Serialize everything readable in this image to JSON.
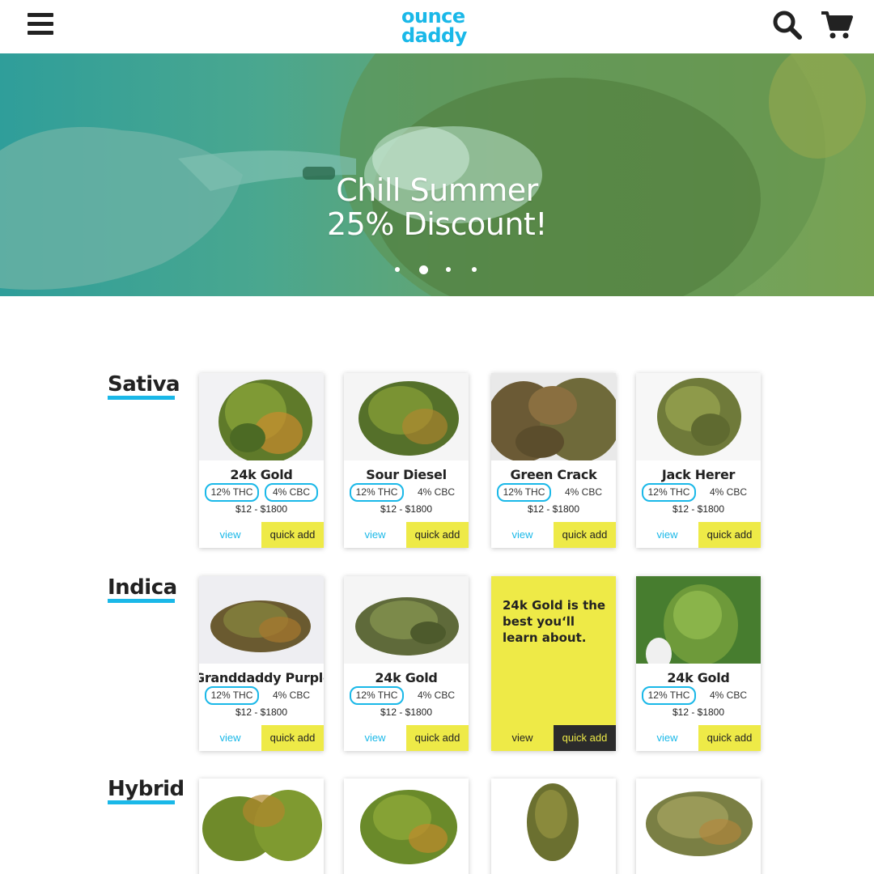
{
  "header": {
    "logo_line1": "ounce",
    "logo_line2": "daddy",
    "menu_icon": "hamburger-menu-icon",
    "search_icon": "search-icon",
    "cart_icon": "shopping-cart-icon"
  },
  "hero": {
    "title_line1": "Chill Summer",
    "title_line2": "25% Discount!",
    "slides": 4,
    "active_slide": 2
  },
  "colors": {
    "accent": "#1ab8e8",
    "highlight": "#eeea47",
    "dark": "#2b2b2b"
  },
  "categories": [
    {
      "title": "Sativa",
      "products": [
        {
          "name": "24k Gold",
          "thc": "12% THC",
          "cbc": "4% CBC",
          "price": "$12 - $1800",
          "view": "view",
          "add": "quick add"
        },
        {
          "name": "Sour Diesel",
          "thc": "12% THC",
          "cbc": "4% CBC",
          "price": "$12 - $1800",
          "view": "view",
          "add": "quick add"
        },
        {
          "name": "Green Crack",
          "thc": "12% THC",
          "cbc": "4% CBC",
          "price": "$12 - $1800",
          "view": "view",
          "add": "quick add"
        },
        {
          "name": "Jack Herer",
          "thc": "12% THC",
          "cbc": "4% CBC",
          "price": "$12 - $1800",
          "view": "view",
          "add": "quick add"
        }
      ]
    },
    {
      "title": "Indica",
      "products": [
        {
          "name": "Granddaddy Purple",
          "thc": "12% THC",
          "cbc": "4% CBC",
          "price": "$12 - $1800",
          "view": "view",
          "add": "quick add"
        },
        {
          "name": "24k Gold",
          "thc": "12% THC",
          "cbc": "4% CBC",
          "price": "$12 - $1800",
          "view": "view",
          "add": "quick add"
        },
        {
          "promo_text": "24k Gold is the best you‘ll learn about.",
          "view": "view",
          "add": "quick add"
        },
        {
          "name": "24k Gold",
          "thc": "12% THC",
          "cbc": "4% CBC",
          "price": "$12 - $1800",
          "view": "view",
          "add": "quick add"
        }
      ]
    },
    {
      "title": "Hybrid"
    }
  ]
}
